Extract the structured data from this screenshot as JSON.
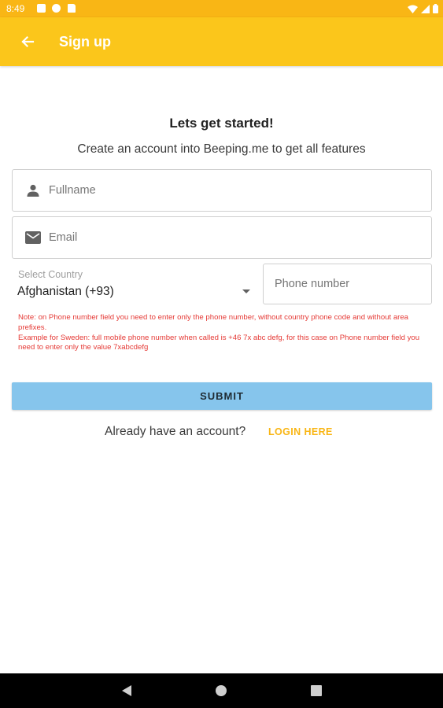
{
  "status_bar": {
    "time": "8:49",
    "notification_icons": [
      "notification-square-icon",
      "notification-p-icon",
      "sd-card-icon"
    ],
    "system_icons": [
      "wifi-icon",
      "signal-icon",
      "battery-icon"
    ]
  },
  "app_bar": {
    "title": "Sign up",
    "back_icon": "arrow-left-icon",
    "color": "#FBC61B"
  },
  "form": {
    "headline": "Lets get started!",
    "subline": "Create an account into Beeping.me to get all features",
    "fullname": {
      "placeholder": "Fullname",
      "value": "",
      "icon": "person-icon"
    },
    "email": {
      "placeholder": "Email",
      "value": "",
      "icon": "email-icon"
    },
    "country": {
      "label": "Select Country",
      "value": "Afghanistan (+93)"
    },
    "phone": {
      "placeholder": "Phone number",
      "value": ""
    },
    "note": "Note: on Phone number field you need to enter only the phone number, without country phone code and without area prefixes.",
    "example": "Example for Sweden: full mobile phone number when called is +46 7x abc defg, for this case on Phone number field you need to enter only the value 7xabcdefg",
    "submit_label": "SUBMIT",
    "already_text": "Already have an account?",
    "login_label": "LOGIN HERE"
  },
  "colors": {
    "accent": "#F9B615",
    "submit": "#86C5EC",
    "note": "#e53935"
  },
  "nav_bar": {
    "icons": [
      "back-triangle-icon",
      "home-circle-icon",
      "recents-square-icon"
    ]
  }
}
